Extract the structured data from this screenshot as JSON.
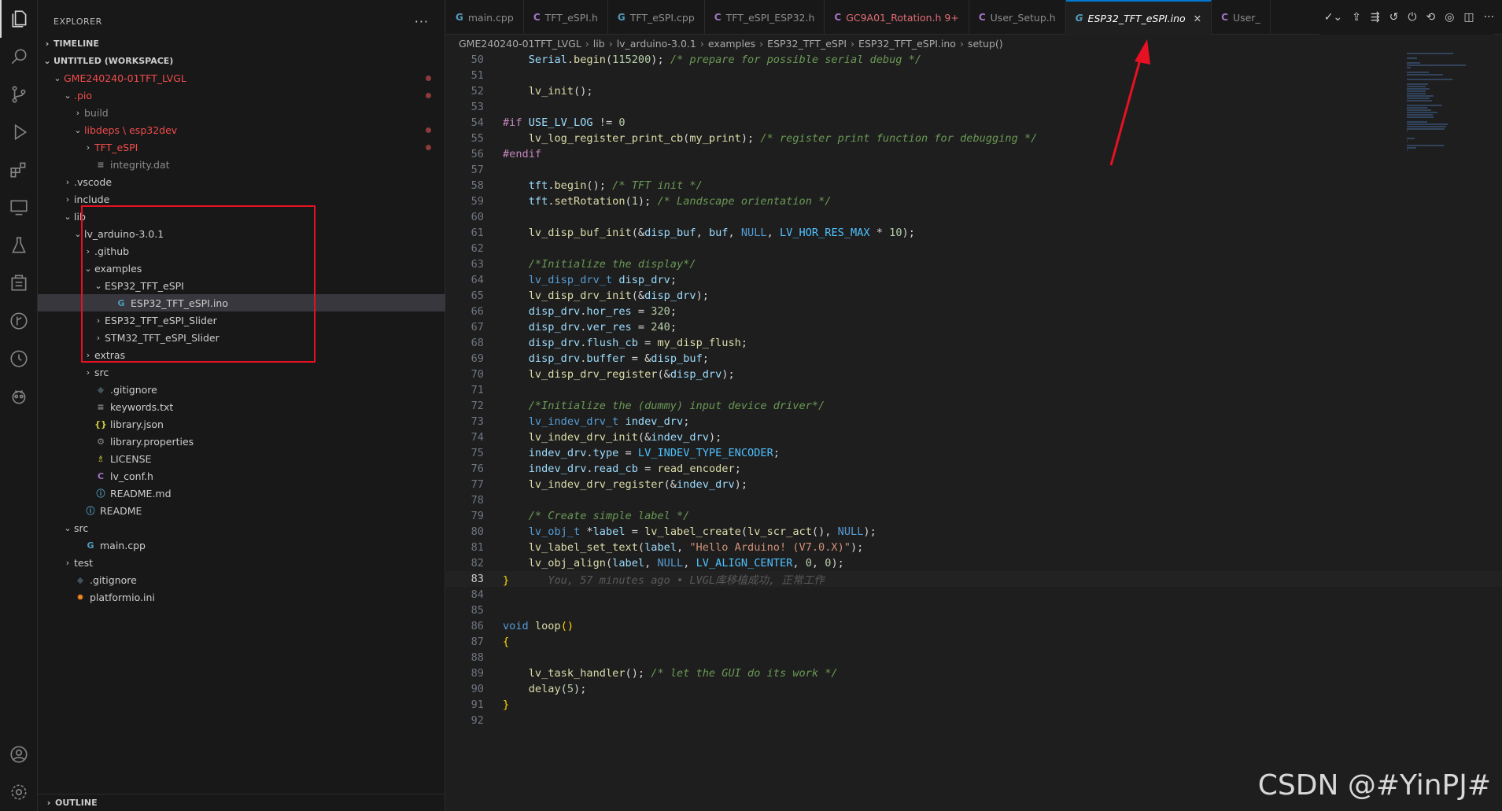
{
  "sidebar": {
    "title": "EXPLORER",
    "more": "···",
    "timeline": "TIMELINE",
    "workspace": "UNTITLED (WORKSPACE)",
    "outline": "OUTLINE",
    "tree": [
      {
        "label": "GME240240-01TFT_LVGL",
        "depth": 1,
        "chev": "v",
        "icon": "",
        "cls": "red",
        "dot": true
      },
      {
        "label": ".pio",
        "depth": 2,
        "chev": "v",
        "icon": "",
        "cls": "red",
        "dot": true
      },
      {
        "label": "build",
        "depth": 3,
        "chev": ">",
        "icon": "",
        "cls": "dim",
        "dot": false
      },
      {
        "label": "libdeps \\ esp32dev",
        "depth": 3,
        "chev": "v",
        "icon": "",
        "cls": "red",
        "dot": true
      },
      {
        "label": "TFT_eSPI",
        "depth": 4,
        "chev": ">",
        "icon": "",
        "cls": "red",
        "dot": true
      },
      {
        "label": "integrity.dat",
        "depth": 4,
        "chev": "",
        "icon": "≡",
        "cls": "dim",
        "dot": false
      },
      {
        "label": ".vscode",
        "depth": 2,
        "chev": ">",
        "icon": "",
        "cls": "",
        "dot": false
      },
      {
        "label": "include",
        "depth": 2,
        "chev": ">",
        "icon": "",
        "cls": "",
        "dot": false
      },
      {
        "label": "lib",
        "depth": 2,
        "chev": "v",
        "icon": "",
        "cls": "",
        "dot": false
      },
      {
        "label": "lv_arduino-3.0.1",
        "depth": 3,
        "chev": "v",
        "icon": "",
        "cls": "",
        "dot": false
      },
      {
        "label": ".github",
        "depth": 4,
        "chev": ">",
        "icon": "",
        "cls": "",
        "dot": false
      },
      {
        "label": "examples",
        "depth": 4,
        "chev": "v",
        "icon": "",
        "cls": "",
        "dot": false
      },
      {
        "label": "ESP32_TFT_eSPI",
        "depth": 5,
        "chev": "v",
        "icon": "",
        "cls": "",
        "dot": false
      },
      {
        "label": "ESP32_TFT_eSPI.ino",
        "depth": 6,
        "chev": "",
        "icon": "G",
        "cls": "selected",
        "dot": false
      },
      {
        "label": "ESP32_TFT_eSPI_Slider",
        "depth": 5,
        "chev": ">",
        "icon": "",
        "cls": "",
        "dot": false
      },
      {
        "label": "STM32_TFT_eSPI_Slider",
        "depth": 5,
        "chev": ">",
        "icon": "",
        "cls": "",
        "dot": false
      },
      {
        "label": "extras",
        "depth": 4,
        "chev": ">",
        "icon": "",
        "cls": "",
        "dot": false
      },
      {
        "label": "src",
        "depth": 4,
        "chev": ">",
        "icon": "",
        "cls": "",
        "dot": false
      },
      {
        "label": ".gitignore",
        "depth": 4,
        "chev": "",
        "icon": "◆",
        "cls": "",
        "dot": false
      },
      {
        "label": "keywords.txt",
        "depth": 4,
        "chev": "",
        "icon": "≡",
        "cls": "",
        "dot": false
      },
      {
        "label": "library.json",
        "depth": 4,
        "chev": "",
        "icon": "{}",
        "cls": "",
        "dot": false
      },
      {
        "label": "library.properties",
        "depth": 4,
        "chev": "",
        "icon": "⚙",
        "cls": "",
        "dot": false
      },
      {
        "label": "LICENSE",
        "depth": 4,
        "chev": "",
        "icon": "♗",
        "cls": "",
        "dot": false
      },
      {
        "label": "lv_conf.h",
        "depth": 4,
        "chev": "",
        "icon": "C",
        "cls": "",
        "dot": false
      },
      {
        "label": "README.md",
        "depth": 4,
        "chev": "",
        "icon": "ⓘ",
        "cls": "",
        "dot": false
      },
      {
        "label": "README",
        "depth": 3,
        "chev": "",
        "icon": "ⓘ",
        "cls": "",
        "dot": false
      },
      {
        "label": "src",
        "depth": 2,
        "chev": "v",
        "icon": "",
        "cls": "",
        "dot": false
      },
      {
        "label": "main.cpp",
        "depth": 3,
        "chev": "",
        "icon": "G",
        "cls": "",
        "dot": false
      },
      {
        "label": "test",
        "depth": 2,
        "chev": ">",
        "icon": "",
        "cls": "",
        "dot": false
      },
      {
        "label": ".gitignore",
        "depth": 2,
        "chev": "",
        "icon": "◆",
        "cls": "",
        "dot": false
      },
      {
        "label": "platformio.ini",
        "depth": 2,
        "chev": "",
        "icon": "✹",
        "cls": "",
        "dot": false
      }
    ]
  },
  "tabs": [
    {
      "icon": "G",
      "label": "main.cpp",
      "color": "#519aba",
      "cls": ""
    },
    {
      "icon": "C",
      "label": "TFT_eSPI.h",
      "color": "#a074c4",
      "cls": ""
    },
    {
      "icon": "G",
      "label": "TFT_eSPI.cpp",
      "color": "#519aba",
      "cls": ""
    },
    {
      "icon": "C",
      "label": "TFT_eSPI_ESP32.h",
      "color": "#a074c4",
      "cls": ""
    },
    {
      "icon": "C",
      "label": "GC9A01_Rotation.h 9+",
      "color": "#a074c4",
      "cls": "warn"
    },
    {
      "icon": "C",
      "label": "User_Setup.h",
      "color": "#a074c4",
      "cls": ""
    },
    {
      "icon": "G",
      "label": "ESP32_TFT_eSPI.ino",
      "color": "#519aba",
      "cls": "active"
    },
    {
      "icon": "C",
      "label": "User_",
      "color": "#a074c4",
      "cls": ""
    }
  ],
  "tab_close": "✕",
  "tab_actions": [
    "✓⌄",
    "⇪",
    "⇶",
    "↺",
    "⏻",
    "⟲",
    "◎",
    "◫",
    "···"
  ],
  "breadcrumb": [
    "GME240240-01TFT_LVGL",
    "lib",
    "lv_arduino-3.0.1",
    "examples",
    "ESP32_TFT_eSPI",
    "ESP32_TFT_eSPI.ino",
    "setup()"
  ],
  "current_line": 83,
  "blame": "You, 57 minutes ago • LVGL库移植成功, 正常工作",
  "watermark": "CSDN @#YinPJ#",
  "code": [
    {
      "n": 50,
      "t": [
        [
          "    ",
          "p"
        ],
        [
          "Serial",
          "v"
        ],
        [
          ".",
          "p"
        ],
        [
          "begin",
          "f"
        ],
        [
          "(",
          "p"
        ],
        [
          "115200",
          "n"
        ],
        [
          "); ",
          "p"
        ],
        [
          "/* prepare for possible serial debug */",
          "c"
        ]
      ]
    },
    {
      "n": 51,
      "t": []
    },
    {
      "n": 52,
      "t": [
        [
          "    ",
          "p"
        ],
        [
          "lv_init",
          "f"
        ],
        [
          "();",
          "p"
        ]
      ]
    },
    {
      "n": 53,
      "t": []
    },
    {
      "n": 54,
      "t": [
        [
          "#if ",
          "mac"
        ],
        [
          "USE_LV_LOG",
          "v"
        ],
        [
          " != ",
          "p"
        ],
        [
          "0",
          "n"
        ]
      ]
    },
    {
      "n": 55,
      "t": [
        [
          "    ",
          "p"
        ],
        [
          "lv_log_register_print_cb",
          "f"
        ],
        [
          "(",
          "p"
        ],
        [
          "my_print",
          "f"
        ],
        [
          "); ",
          "p"
        ],
        [
          "/* register print function for debugging */",
          "c"
        ]
      ]
    },
    {
      "n": 56,
      "t": [
        [
          "#endif",
          "mac"
        ]
      ]
    },
    {
      "n": 57,
      "t": []
    },
    {
      "n": 58,
      "t": [
        [
          "    ",
          "p"
        ],
        [
          "tft",
          "v"
        ],
        [
          ".",
          "p"
        ],
        [
          "begin",
          "f"
        ],
        [
          "(); ",
          "p"
        ],
        [
          "/* TFT init */",
          "c"
        ]
      ]
    },
    {
      "n": 59,
      "t": [
        [
          "    ",
          "p"
        ],
        [
          "tft",
          "v"
        ],
        [
          ".",
          "p"
        ],
        [
          "setRotation",
          "f"
        ],
        [
          "(",
          "p"
        ],
        [
          "1",
          "n"
        ],
        [
          "); ",
          "p"
        ],
        [
          "/* Landscape orientation */",
          "c"
        ]
      ]
    },
    {
      "n": 60,
      "t": []
    },
    {
      "n": 61,
      "t": [
        [
          "    ",
          "p"
        ],
        [
          "lv_disp_buf_init",
          "f"
        ],
        [
          "(&",
          "p"
        ],
        [
          "disp_buf",
          "v"
        ],
        [
          ", ",
          "p"
        ],
        [
          "buf",
          "v"
        ],
        [
          ", ",
          "p"
        ],
        [
          "NULL",
          "t"
        ],
        [
          ", ",
          "p"
        ],
        [
          "LV_HOR_RES_MAX",
          "m"
        ],
        [
          " * ",
          "p"
        ],
        [
          "10",
          "n"
        ],
        [
          ");",
          "p"
        ]
      ]
    },
    {
      "n": 62,
      "t": []
    },
    {
      "n": 63,
      "t": [
        [
          "    ",
          "p"
        ],
        [
          "/*Initialize the display*/",
          "c"
        ]
      ]
    },
    {
      "n": 64,
      "t": [
        [
          "    ",
          "p"
        ],
        [
          "lv_disp_drv_t",
          "t"
        ],
        [
          " ",
          "p"
        ],
        [
          "disp_drv",
          "v"
        ],
        [
          ";",
          "p"
        ]
      ]
    },
    {
      "n": 65,
      "t": [
        [
          "    ",
          "p"
        ],
        [
          "lv_disp_drv_init",
          "f"
        ],
        [
          "(&",
          "p"
        ],
        [
          "disp_drv",
          "v"
        ],
        [
          ");",
          "p"
        ]
      ]
    },
    {
      "n": 66,
      "t": [
        [
          "    ",
          "p"
        ],
        [
          "disp_drv",
          "v"
        ],
        [
          ".",
          "p"
        ],
        [
          "hor_res",
          "v"
        ],
        [
          " = ",
          "p"
        ],
        [
          "320",
          "n"
        ],
        [
          ";",
          "p"
        ]
      ]
    },
    {
      "n": 67,
      "t": [
        [
          "    ",
          "p"
        ],
        [
          "disp_drv",
          "v"
        ],
        [
          ".",
          "p"
        ],
        [
          "ver_res",
          "v"
        ],
        [
          " = ",
          "p"
        ],
        [
          "240",
          "n"
        ],
        [
          ";",
          "p"
        ]
      ]
    },
    {
      "n": 68,
      "t": [
        [
          "    ",
          "p"
        ],
        [
          "disp_drv",
          "v"
        ],
        [
          ".",
          "p"
        ],
        [
          "flush_cb",
          "v"
        ],
        [
          " = ",
          "p"
        ],
        [
          "my_disp_flush",
          "f"
        ],
        [
          ";",
          "p"
        ]
      ]
    },
    {
      "n": 69,
      "t": [
        [
          "    ",
          "p"
        ],
        [
          "disp_drv",
          "v"
        ],
        [
          ".",
          "p"
        ],
        [
          "buffer",
          "v"
        ],
        [
          " = &",
          "p"
        ],
        [
          "disp_buf",
          "v"
        ],
        [
          ";",
          "p"
        ]
      ]
    },
    {
      "n": 70,
      "t": [
        [
          "    ",
          "p"
        ],
        [
          "lv_disp_drv_register",
          "f"
        ],
        [
          "(&",
          "p"
        ],
        [
          "disp_drv",
          "v"
        ],
        [
          ");",
          "p"
        ]
      ]
    },
    {
      "n": 71,
      "t": []
    },
    {
      "n": 72,
      "t": [
        [
          "    ",
          "p"
        ],
        [
          "/*Initialize the (dummy) input device driver*/",
          "c"
        ]
      ]
    },
    {
      "n": 73,
      "t": [
        [
          "    ",
          "p"
        ],
        [
          "lv_indev_drv_t",
          "t"
        ],
        [
          " ",
          "p"
        ],
        [
          "indev_drv",
          "v"
        ],
        [
          ";",
          "p"
        ]
      ]
    },
    {
      "n": 74,
      "t": [
        [
          "    ",
          "p"
        ],
        [
          "lv_indev_drv_init",
          "f"
        ],
        [
          "(&",
          "p"
        ],
        [
          "indev_drv",
          "v"
        ],
        [
          ");",
          "p"
        ]
      ]
    },
    {
      "n": 75,
      "t": [
        [
          "    ",
          "p"
        ],
        [
          "indev_drv",
          "v"
        ],
        [
          ".",
          "p"
        ],
        [
          "type",
          "v"
        ],
        [
          " = ",
          "p"
        ],
        [
          "LV_INDEV_TYPE_ENCODER",
          "m"
        ],
        [
          ";",
          "p"
        ]
      ]
    },
    {
      "n": 76,
      "t": [
        [
          "    ",
          "p"
        ],
        [
          "indev_drv",
          "v"
        ],
        [
          ".",
          "p"
        ],
        [
          "read_cb",
          "v"
        ],
        [
          " = ",
          "p"
        ],
        [
          "read_encoder",
          "f"
        ],
        [
          ";",
          "p"
        ]
      ]
    },
    {
      "n": 77,
      "t": [
        [
          "    ",
          "p"
        ],
        [
          "lv_indev_drv_register",
          "f"
        ],
        [
          "(&",
          "p"
        ],
        [
          "indev_drv",
          "v"
        ],
        [
          ");",
          "p"
        ]
      ]
    },
    {
      "n": 78,
      "t": []
    },
    {
      "n": 79,
      "t": [
        [
          "    ",
          "p"
        ],
        [
          "/* Create simple label */",
          "c"
        ]
      ]
    },
    {
      "n": 80,
      "t": [
        [
          "    ",
          "p"
        ],
        [
          "lv_obj_t",
          "t"
        ],
        [
          " *",
          "p"
        ],
        [
          "label",
          "v"
        ],
        [
          " = ",
          "p"
        ],
        [
          "lv_label_create",
          "f"
        ],
        [
          "(",
          "p"
        ],
        [
          "lv_scr_act",
          "f"
        ],
        [
          "(), ",
          "p"
        ],
        [
          "NULL",
          "t"
        ],
        [
          ");",
          "p"
        ]
      ]
    },
    {
      "n": 81,
      "t": [
        [
          "    ",
          "p"
        ],
        [
          "lv_label_set_text",
          "f"
        ],
        [
          "(",
          "p"
        ],
        [
          "label",
          "v"
        ],
        [
          ", ",
          "p"
        ],
        [
          "\"Hello Arduino! (V7.0.X)\"",
          "s"
        ],
        [
          ");",
          "p"
        ]
      ]
    },
    {
      "n": 82,
      "t": [
        [
          "    ",
          "p"
        ],
        [
          "lv_obj_align",
          "f"
        ],
        [
          "(",
          "p"
        ],
        [
          "label",
          "v"
        ],
        [
          ", ",
          "p"
        ],
        [
          "NULL",
          "t"
        ],
        [
          ", ",
          "p"
        ],
        [
          "LV_ALIGN_CENTER",
          "m"
        ],
        [
          ", ",
          "p"
        ],
        [
          "0",
          "n"
        ],
        [
          ", ",
          "p"
        ],
        [
          "0",
          "n"
        ],
        [
          ");",
          "p"
        ]
      ]
    },
    {
      "n": 83,
      "t": [
        [
          "}",
          "br"
        ]
      ],
      "blame": true
    },
    {
      "n": 84,
      "t": []
    },
    {
      "n": 85,
      "t": []
    },
    {
      "n": 86,
      "t": [
        [
          "void",
          "t"
        ],
        [
          " ",
          "p"
        ],
        [
          "loop",
          "f"
        ],
        [
          "()",
          "br"
        ]
      ]
    },
    {
      "n": 87,
      "t": [
        [
          "{",
          "br"
        ]
      ]
    },
    {
      "n": 88,
      "t": []
    },
    {
      "n": 89,
      "t": [
        [
          "    ",
          "p"
        ],
        [
          "lv_task_handler",
          "f"
        ],
        [
          "(); ",
          "p"
        ],
        [
          "/* let the GUI do its work */",
          "c"
        ]
      ]
    },
    {
      "n": 90,
      "t": [
        [
          "    ",
          "p"
        ],
        [
          "delay",
          "f"
        ],
        [
          "(",
          "p"
        ],
        [
          "5",
          "n"
        ],
        [
          ");",
          "p"
        ]
      ]
    },
    {
      "n": 91,
      "t": [
        [
          "}",
          "br"
        ]
      ]
    },
    {
      "n": 92,
      "t": []
    }
  ]
}
